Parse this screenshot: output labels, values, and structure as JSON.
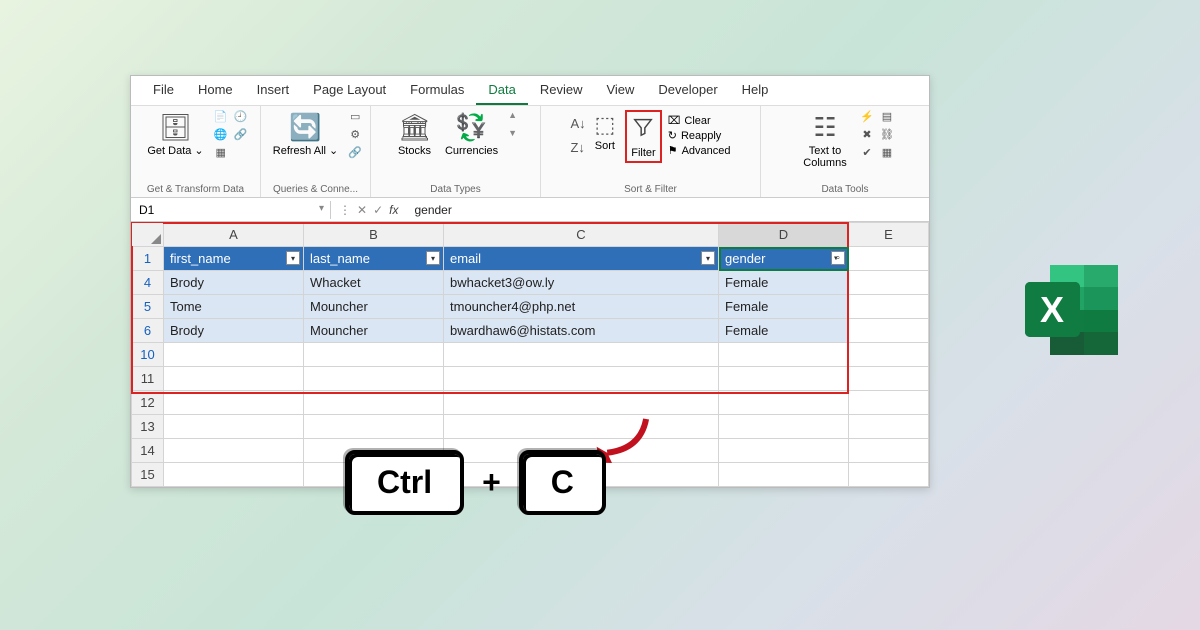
{
  "tabs": [
    "File",
    "Home",
    "Insert",
    "Page Layout",
    "Formulas",
    "Data",
    "Review",
    "View",
    "Developer",
    "Help"
  ],
  "active_tab": "Data",
  "ribbon": {
    "get_data": {
      "label": "Get Data ⌄",
      "group": "Get & Transform Data"
    },
    "refresh": {
      "label": "Refresh All ⌄",
      "group": "Queries & Conne..."
    },
    "stocks": "Stocks",
    "currencies": "Currencies",
    "data_types": "Data Types",
    "sort": "Sort",
    "filter": "Filter",
    "clear": "Clear",
    "reapply": "Reapply",
    "advanced": "Advanced",
    "sort_filter": "Sort & Filter",
    "text_to_cols": "Text to Columns",
    "data_tools": "Data Tools"
  },
  "name_box": "D1",
  "formula": "gender",
  "columns": [
    "A",
    "B",
    "C",
    "D",
    "E"
  ],
  "headers": {
    "a": "first_name",
    "b": "last_name",
    "c": "email",
    "d": "gender"
  },
  "rows": [
    {
      "n": "4",
      "a": "Brody",
      "b": "Whacket",
      "c": "bwhacket3@ow.ly",
      "d": "Female"
    },
    {
      "n": "5",
      "a": "Tome",
      "b": "Mouncher",
      "c": "tmouncher4@php.net",
      "d": "Female"
    },
    {
      "n": "6",
      "a": "Brody",
      "b": "Mouncher",
      "c": "bwardhaw6@histats.com",
      "d": "Female"
    }
  ],
  "empty_rows": [
    "10",
    "11",
    "12",
    "13",
    "14",
    "15"
  ],
  "keys": {
    "k1": "Ctrl",
    "plus": "+",
    "k2": "C"
  }
}
